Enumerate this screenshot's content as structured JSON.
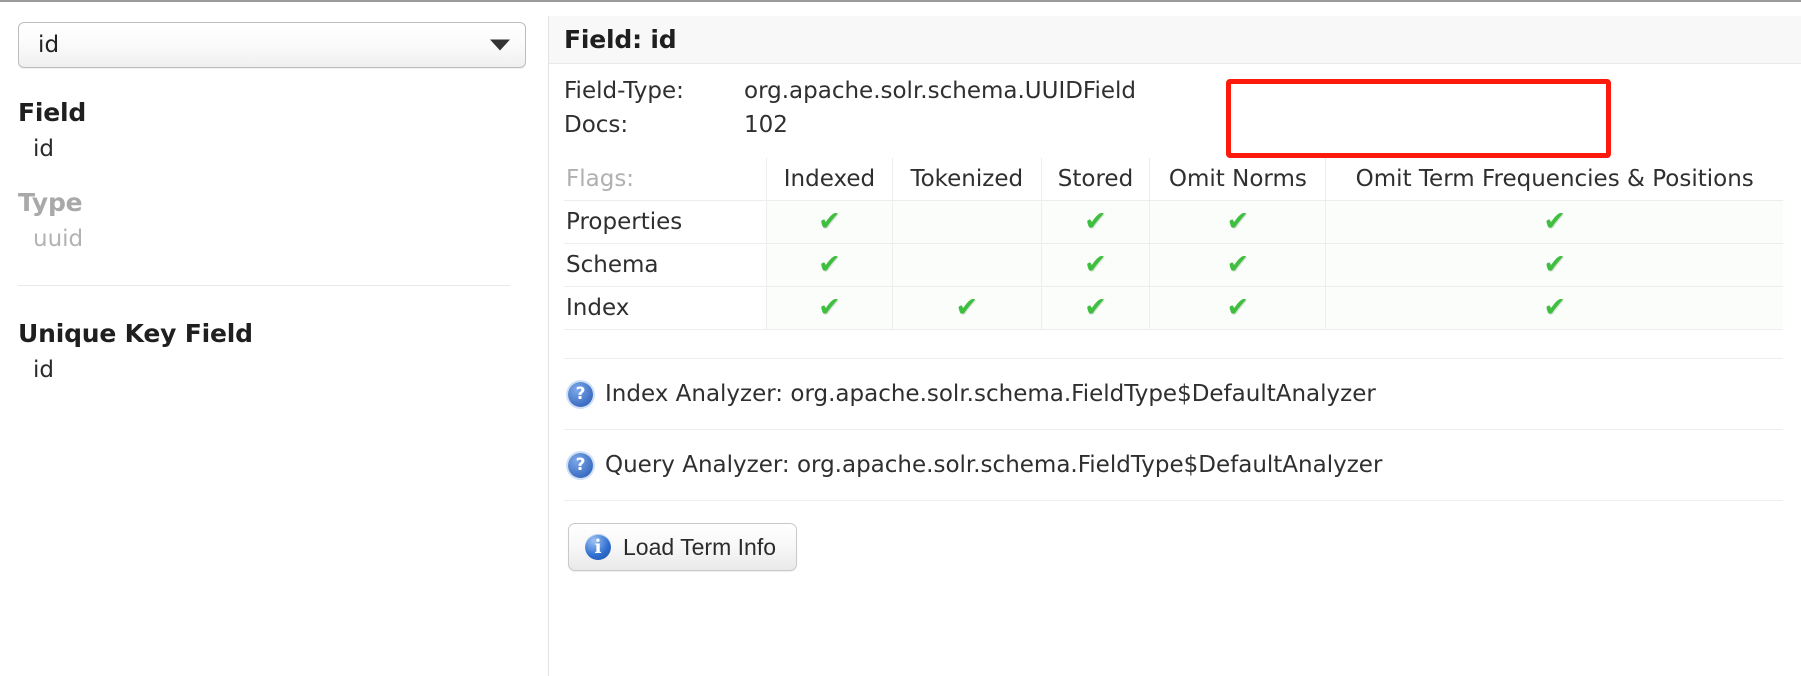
{
  "colors": {
    "annotation_box": "#fb1a0c",
    "check_green": "#3fbf3f",
    "muted_text": "#b0b0b0",
    "panel_header_bg": "#f8f8f8",
    "info_blue": "#2f6fd0"
  },
  "sidebar": {
    "field_select": {
      "value": "id",
      "caret_icon": "chevron-down-icon"
    },
    "field_heading": "Field",
    "field_value": "id",
    "type_heading": "Type",
    "type_value": "uuid",
    "unique_key_heading": "Unique Key Field",
    "unique_key_value": "id"
  },
  "panel": {
    "title": "Field: id",
    "summary": [
      {
        "key": "Field-Type:",
        "value": "org.apache.solr.schema.UUIDField"
      },
      {
        "key": "Docs:",
        "value": "102"
      }
    ],
    "flags_table": {
      "row_header_label": "Flags:",
      "columns": [
        "Indexed",
        "Tokenized",
        "Stored",
        "Omit Norms",
        "Omit Term Frequencies & Positions"
      ],
      "check_glyph": "✔",
      "rows": [
        {
          "label": "Properties",
          "values": [
            true,
            false,
            true,
            true,
            true
          ]
        },
        {
          "label": "Schema",
          "values": [
            true,
            false,
            true,
            true,
            true
          ]
        },
        {
          "label": "Index",
          "values": [
            true,
            true,
            true,
            true,
            true
          ]
        }
      ]
    },
    "analyzers": [
      {
        "help_icon": "question-circle-icon",
        "label": "Index Analyzer:",
        "value": "org.apache.solr.schema.FieldType$DefaultAnalyzer"
      },
      {
        "help_icon": "question-circle-icon",
        "label": "Query Analyzer:",
        "value": "org.apache.solr.schema.FieldType$DefaultAnalyzer"
      }
    ],
    "load_term_info_button": {
      "label": "Load Term Info",
      "icon": "info-circle-icon",
      "icon_glyph": "i"
    }
  }
}
